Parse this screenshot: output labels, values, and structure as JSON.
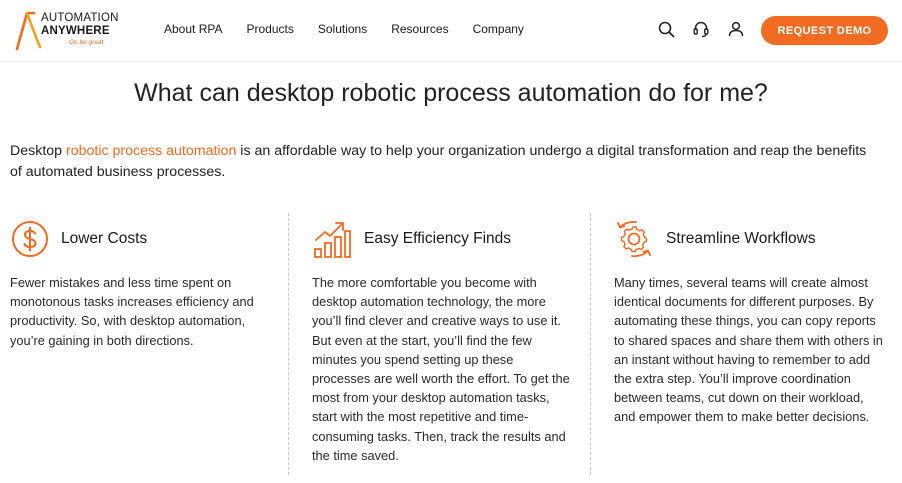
{
  "brand": {
    "line1": "AUTOMATION",
    "line2": "ANYWHERE",
    "tagline": "Go be great.",
    "accent_color": "#f26b21"
  },
  "nav": {
    "items": [
      {
        "label": "About RPA"
      },
      {
        "label": "Products"
      },
      {
        "label": "Solutions"
      },
      {
        "label": "Resources"
      },
      {
        "label": "Company"
      }
    ]
  },
  "utility_icons": [
    "search-icon",
    "headset-icon",
    "user-icon"
  ],
  "cta": {
    "label": "REQUEST DEMO"
  },
  "main": {
    "title": "What can desktop robotic process automation do for me?",
    "intro": {
      "before": "Desktop ",
      "link": "robotic process automation",
      "after": " is an affordable way to help your organization undergo a digital transformation and reap the benefits of automated business processes."
    },
    "features": [
      {
        "icon": "dollar-circle-icon",
        "title": "Lower Costs",
        "body": "Fewer mistakes and less time spent on monotonous tasks increases efficiency and productivity. So, with desktop automation, you’re gaining in both directions."
      },
      {
        "icon": "growth-chart-icon",
        "title": "Easy Efficiency Finds",
        "body": "The more comfortable you become with desktop automation technology, the more you’ll find clever and creative ways to use it. But even at the start, you’ll find the few minutes you spend setting up these processes are well worth the effort. To get the most from your desktop automation tasks, start with the most repetitive and time-consuming tasks. Then, track the results and the time saved."
      },
      {
        "icon": "gear-cycle-icon",
        "title": "Streamline Workflows",
        "body": "Many times, several teams will create almost identical documents for different purposes. By automating these things, you can copy reports to shared spaces and share them with others in an instant without having to remember to add the extra step. You’ll improve coordination between teams, cut down on their workload, and empower them to make better decisions."
      }
    ]
  }
}
